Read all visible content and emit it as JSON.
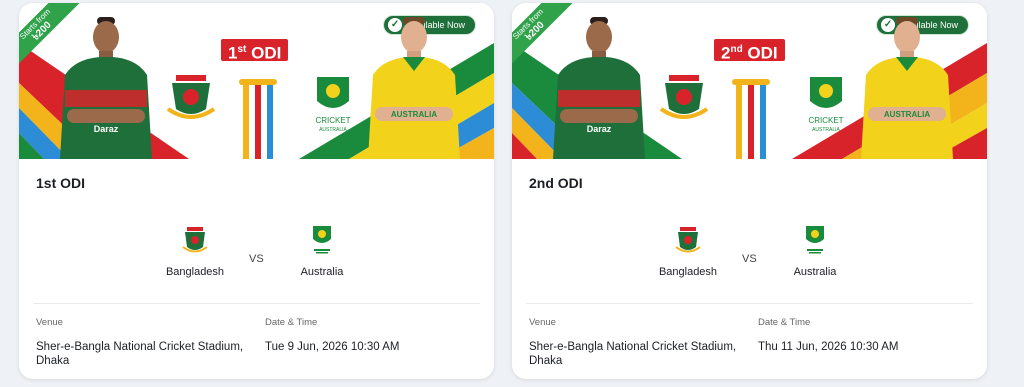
{
  "cards": [
    {
      "ribbon_line1": "Starts from",
      "ribbon_line2": "৳200",
      "availability": "Available Now",
      "badge_main": "1",
      "badge_sup": "st",
      "badge_rest": " ODI",
      "title": "1st ODI",
      "team1": "Bangladesh",
      "team2": "Australia",
      "vs": "VS",
      "venue_label": "Venue",
      "venue": "Sher-e-Bangla National Cricket Stadium, Dhaka",
      "date_label": "Date & Time",
      "date": "Tue 9 Jun, 2026 10:30 AM",
      "jersey_left": "Daraz",
      "jersey_right": "AUSTRALIA",
      "au_logo_text": "CRICKET",
      "au_logo_sub": "AUSTRALIA"
    },
    {
      "ribbon_line1": "Starts from",
      "ribbon_line2": "৳200",
      "availability": "Available Now",
      "badge_main": "2",
      "badge_sup": "nd",
      "badge_rest": " ODI",
      "title": "2nd ODI",
      "team1": "Bangladesh",
      "team2": "Australia",
      "vs": "VS",
      "venue_label": "Venue",
      "venue": "Sher-e-Bangla National Cricket Stadium, Dhaka",
      "date_label": "Date & Time",
      "date": "Thu 11 Jun, 2026 10:30 AM",
      "jersey_left": "Daraz",
      "jersey_right": "AUSTRALIA",
      "au_logo_text": "CRICKET",
      "au_logo_sub": "AUSTRALIA"
    }
  ],
  "colors": {
    "bd_green": "#1f6f3a",
    "bd_red": "#d9232a",
    "au_yellow": "#f2d21b",
    "au_green": "#1a8b3d",
    "ribbon_green": "#2fa24a"
  }
}
